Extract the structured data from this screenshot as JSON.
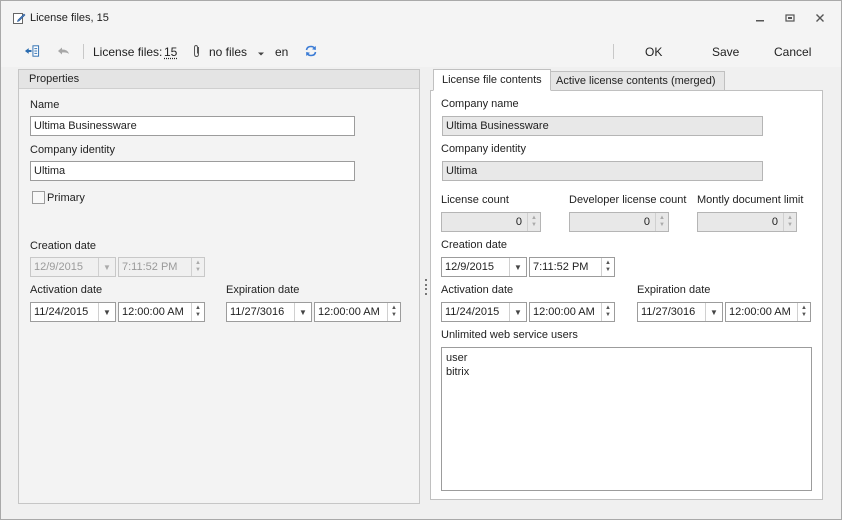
{
  "window": {
    "title": "License files, 15"
  },
  "toolbar": {
    "license_files_label": "License files:",
    "license_files_count": "15",
    "attachments_label": "no files",
    "language": "en",
    "ok_label": "OK",
    "save_label": "Save",
    "cancel_label": "Cancel"
  },
  "properties": {
    "header": "Properties",
    "name_label": "Name",
    "name_value": "Ultima Businessware",
    "company_identity_label": "Company identity",
    "company_identity_value": "Ultima",
    "primary_label": "Primary",
    "creation_date_label": "Creation date",
    "creation_date": "12/9/2015",
    "creation_time": "7:11:52 PM",
    "activation_date_label": "Activation date",
    "activation_date": "11/24/2015",
    "activation_time": "12:00:00 AM",
    "expiration_date_label": "Expiration date",
    "expiration_date": "11/27/3016",
    "expiration_time": "12:00:00 AM"
  },
  "tabs": [
    {
      "label": "License file contents",
      "active": true
    },
    {
      "label": "Active license contents (merged)",
      "active": false
    }
  ],
  "contents": {
    "company_name_label": "Company name",
    "company_name_value": "Ultima Businessware",
    "company_identity_label": "Company identity",
    "company_identity_value": "Ultima",
    "license_count_label": "License count",
    "license_count": "0",
    "developer_license_count_label": "Developer license count",
    "developer_license_count": "0",
    "monthly_limit_label": "Montly document limit",
    "monthly_limit": "0",
    "creation_date_label": "Creation date",
    "creation_date": "12/9/2015",
    "creation_time": "7:11:52 PM",
    "activation_date_label": "Activation date",
    "activation_date": "11/24/2015",
    "activation_time": "12:00:00 AM",
    "expiration_date_label": "Expiration date",
    "expiration_date": "11/27/3016",
    "expiration_time": "12:00:00 AM",
    "unlimited_users_label": "Unlimited web service users",
    "unlimited_users": [
      "user",
      "bitrix"
    ]
  },
  "icons": {
    "title": "edit-document-icon",
    "toolbar_left": "navigate-list-icon",
    "reply": "reply-icon",
    "attachment": "paperclip-icon",
    "refresh": "refresh-icon"
  },
  "colors": {
    "refresh_accent": "#3a7bd5",
    "nav_accent": "#2b6cb0"
  }
}
